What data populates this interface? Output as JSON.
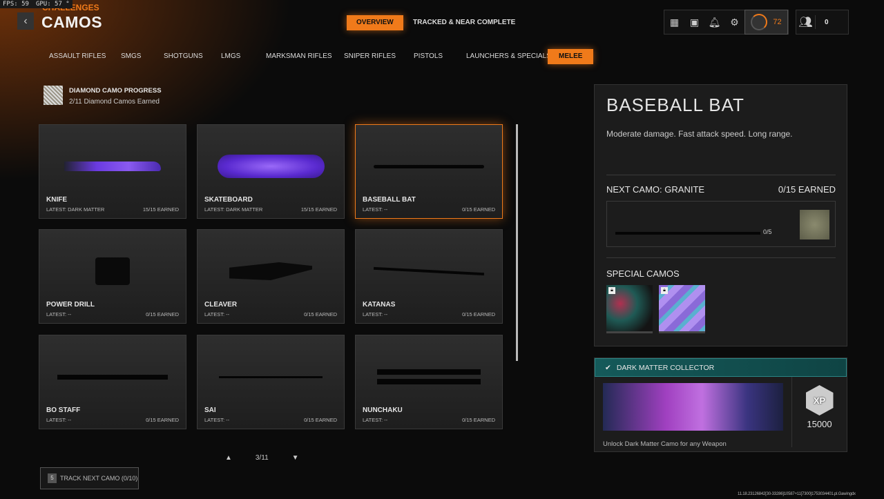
{
  "overlay": {
    "fps": "FPS: 59",
    "gpu": "GPU: 57 °"
  },
  "header": {
    "supertitle": "CHALLENGES",
    "title": "CAMOS",
    "back_icon": "chevron-left-icon"
  },
  "top_tabs": [
    {
      "label": "OVERVIEW",
      "active": true
    },
    {
      "label": "TRACKED & NEAR COMPLETE",
      "active": false
    }
  ],
  "hud": {
    "level": "72",
    "party_count": "0"
  },
  "categories": [
    {
      "label": "ASSAULT RIFLES"
    },
    {
      "label": "SMGS"
    },
    {
      "label": "SHOTGUNS"
    },
    {
      "label": "LMGS"
    },
    {
      "label": "MARKSMAN RIFLES"
    },
    {
      "label": "SNIPER RIFLES"
    },
    {
      "label": "PISTOLS"
    },
    {
      "label": "LAUNCHERS & SPECIALS"
    },
    {
      "label": "MELEE",
      "active": true
    }
  ],
  "diamond": {
    "title": "DIAMOND CAMO PROGRESS",
    "subtitle": "2/11 Diamond Camos Earned"
  },
  "weapons": [
    {
      "name": "KNIFE",
      "latest": "LATEST: DARK MATTER",
      "earned": "15/15 EARNED"
    },
    {
      "name": "SKATEBOARD",
      "latest": "LATEST: DARK MATTER",
      "earned": "15/15 EARNED"
    },
    {
      "name": "BASEBALL BAT",
      "latest": "LATEST: --",
      "earned": "0/15 EARNED",
      "selected": true
    },
    {
      "name": "POWER DRILL",
      "latest": "LATEST: --",
      "earned": "0/15 EARNED"
    },
    {
      "name": "CLEAVER",
      "latest": "LATEST: --",
      "earned": "0/15 EARNED"
    },
    {
      "name": "KATANAS",
      "latest": "LATEST: --",
      "earned": "0/15 EARNED"
    },
    {
      "name": "BO STAFF",
      "latest": "LATEST: --",
      "earned": "0/15 EARNED"
    },
    {
      "name": "SAI",
      "latest": "LATEST: --",
      "earned": "0/15 EARNED"
    },
    {
      "name": "NUNCHAKU",
      "latest": "LATEST: --",
      "earned": "0/15 EARNED"
    }
  ],
  "pager": {
    "page": "3/11"
  },
  "track": {
    "key": "5",
    "label": "TRACK NEXT CAMO (0/10)"
  },
  "detail": {
    "title": "BASEBALL BAT",
    "description": "Moderate damage.  Fast attack speed. Long range.",
    "next_camo": "NEXT CAMO: GRANITE",
    "next_earned": "0/15 EARNED",
    "progress_text": "0/5",
    "progress": 0,
    "special_camos": "SPECIAL CAMOS"
  },
  "challenge": {
    "title": "DARK MATTER COLLECTOR",
    "xp": "15000",
    "xp_icon": "XP",
    "description": "Unlock Dark Matter Camo for any Weapon"
  },
  "build_info": "11.18.23126842[30-33286]10587+11[7300]1753034401.pl.Gawingdx",
  "colors": {
    "accent": "#f07a1a",
    "teal": "#155a5a"
  }
}
